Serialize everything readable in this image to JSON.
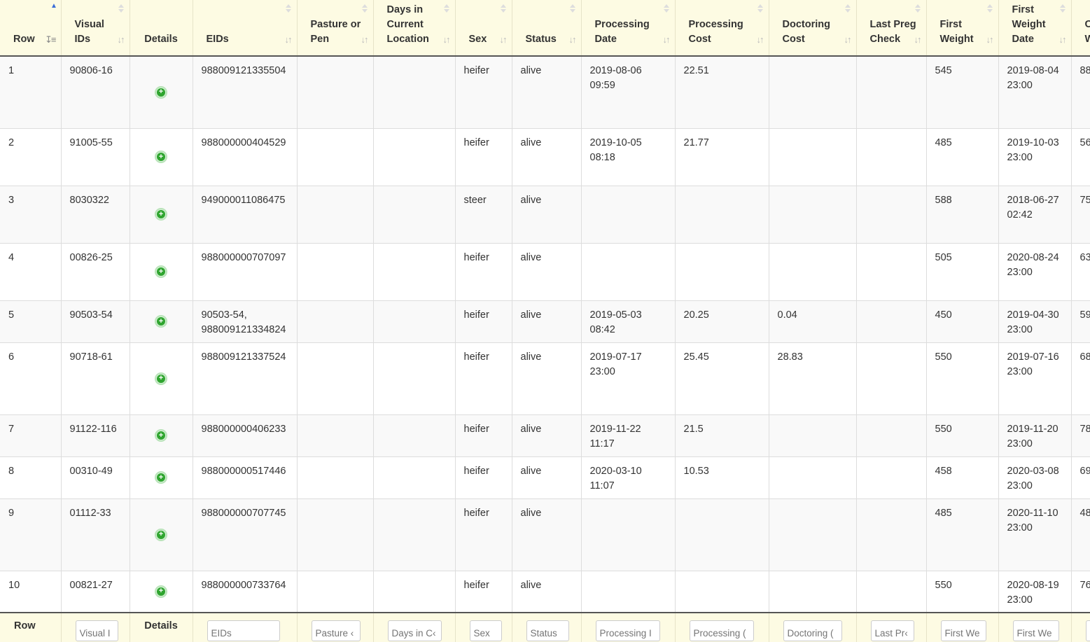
{
  "columns": [
    {
      "key": "row",
      "label": "Row"
    },
    {
      "key": "visual_ids",
      "label": "Visual IDs"
    },
    {
      "key": "details",
      "label": "Details"
    },
    {
      "key": "eids",
      "label": "EIDs"
    },
    {
      "key": "pasture",
      "label": "Pasture or Pen"
    },
    {
      "key": "days",
      "label": "Days in Current Location"
    },
    {
      "key": "sex",
      "label": "Sex"
    },
    {
      "key": "status",
      "label": "Status"
    },
    {
      "key": "proc_date",
      "label": "Processing Date"
    },
    {
      "key": "proc_cost",
      "label": "Processing Cost"
    },
    {
      "key": "doc_cost",
      "label": "Doctoring Cost"
    },
    {
      "key": "preg",
      "label": "Last Preg Check"
    },
    {
      "key": "first_weight",
      "label": "First Weight"
    },
    {
      "key": "first_weight_date",
      "label": "First Weight Date"
    },
    {
      "key": "current_weight",
      "label": "C\nW"
    }
  ],
  "sort": {
    "column": "Row",
    "direction": "ascending"
  },
  "details_icon": "plus-circle-icon",
  "accent_color": "#2fa52f",
  "rows": [
    {
      "row": "1",
      "visual_ids": "90806-16",
      "eids": "988009121335504",
      "pasture": "",
      "days": "",
      "sex": "heifer",
      "status": "alive",
      "proc_date": "2019-08-06\n09:59",
      "proc_cost": "22.51",
      "doc_cost": "",
      "preg": "",
      "first_weight": "545",
      "first_weight_date": "2019-08-04\n23:00",
      "current_weight": "88"
    },
    {
      "row": "2",
      "visual_ids": "91005-55",
      "eids": "988000000404529",
      "pasture": "",
      "days": "",
      "sex": "heifer",
      "status": "alive",
      "proc_date": "2019-10-05\n08:18",
      "proc_cost": "21.77",
      "doc_cost": "",
      "preg": "",
      "first_weight": "485",
      "first_weight_date": "2019-10-03\n23:00",
      "current_weight": "56"
    },
    {
      "row": "3",
      "visual_ids": "8030322",
      "eids": "949000011086475",
      "pasture": "",
      "days": "",
      "sex": "steer",
      "status": "alive",
      "proc_date": "",
      "proc_cost": "",
      "doc_cost": "",
      "preg": "",
      "first_weight": "588",
      "first_weight_date": "2018-06-27\n02:42",
      "current_weight": "75"
    },
    {
      "row": "4",
      "visual_ids": "00826-25",
      "eids": "988000000707097",
      "pasture": "",
      "days": "",
      "sex": "heifer",
      "status": "alive",
      "proc_date": "",
      "proc_cost": "",
      "doc_cost": "",
      "preg": "",
      "first_weight": "505",
      "first_weight_date": "2020-08-24\n23:00",
      "current_weight": "63"
    },
    {
      "row": "5",
      "visual_ids": "90503-54",
      "eids": "90503-54,\n988009121334824",
      "pasture": "",
      "days": "",
      "sex": "heifer",
      "status": "alive",
      "proc_date": "2019-05-03\n08:42",
      "proc_cost": "20.25",
      "doc_cost": "0.04",
      "preg": "",
      "first_weight": "450",
      "first_weight_date": "2019-04-30\n23:00",
      "current_weight": "59"
    },
    {
      "row": "6",
      "visual_ids": "90718-61",
      "eids": "988009121337524",
      "pasture": "",
      "days": "",
      "sex": "heifer",
      "status": "alive",
      "proc_date": "2019-07-17\n23:00",
      "proc_cost": "25.45",
      "doc_cost": "28.83",
      "preg": "",
      "first_weight": "550",
      "first_weight_date": "2019-07-16\n23:00",
      "current_weight": "68"
    },
    {
      "row": "7",
      "visual_ids": "91122-116",
      "eids": "988000000406233",
      "pasture": "",
      "days": "",
      "sex": "heifer",
      "status": "alive",
      "proc_date": "2019-11-22\n11:17",
      "proc_cost": "21.5",
      "doc_cost": "",
      "preg": "",
      "first_weight": "550",
      "first_weight_date": "2019-11-20\n23:00",
      "current_weight": "78"
    },
    {
      "row": "8",
      "visual_ids": "00310-49",
      "eids": "988000000517446",
      "pasture": "",
      "days": "",
      "sex": "heifer",
      "status": "alive",
      "proc_date": "2020-03-10\n11:07",
      "proc_cost": "10.53",
      "doc_cost": "",
      "preg": "",
      "first_weight": "458",
      "first_weight_date": "2020-03-08\n23:00",
      "current_weight": "69"
    },
    {
      "row": "9",
      "visual_ids": "01112-33",
      "eids": "988000000707745",
      "pasture": "",
      "days": "",
      "sex": "heifer",
      "status": "alive",
      "proc_date": "",
      "proc_cost": "",
      "doc_cost": "",
      "preg": "",
      "first_weight": "485",
      "first_weight_date": "2020-11-10\n23:00",
      "current_weight": "48"
    },
    {
      "row": "10",
      "visual_ids": "00821-27",
      "eids": "988000000733764",
      "pasture": "",
      "days": "",
      "sex": "heifer",
      "status": "alive",
      "proc_date": "",
      "proc_cost": "",
      "doc_cost": "",
      "preg": "",
      "first_weight": "550",
      "first_weight_date": "2020-08-19\n23:00",
      "current_weight": "76"
    }
  ],
  "footer": {
    "row_label": "Row",
    "details_label": "Details",
    "filters": {
      "visual_ids": "Visual I",
      "eids": "EIDs",
      "pasture": "Pasture ‹",
      "days": "Days in C‹",
      "sex": "Sex",
      "status": "Status",
      "proc_date": "Processing I",
      "proc_cost": "Processing (",
      "doc_cost": "Doctoring (",
      "preg": "Last Pr‹",
      "first_weight": "First We",
      "first_weight_date": "First We",
      "current_weight": ""
    }
  }
}
